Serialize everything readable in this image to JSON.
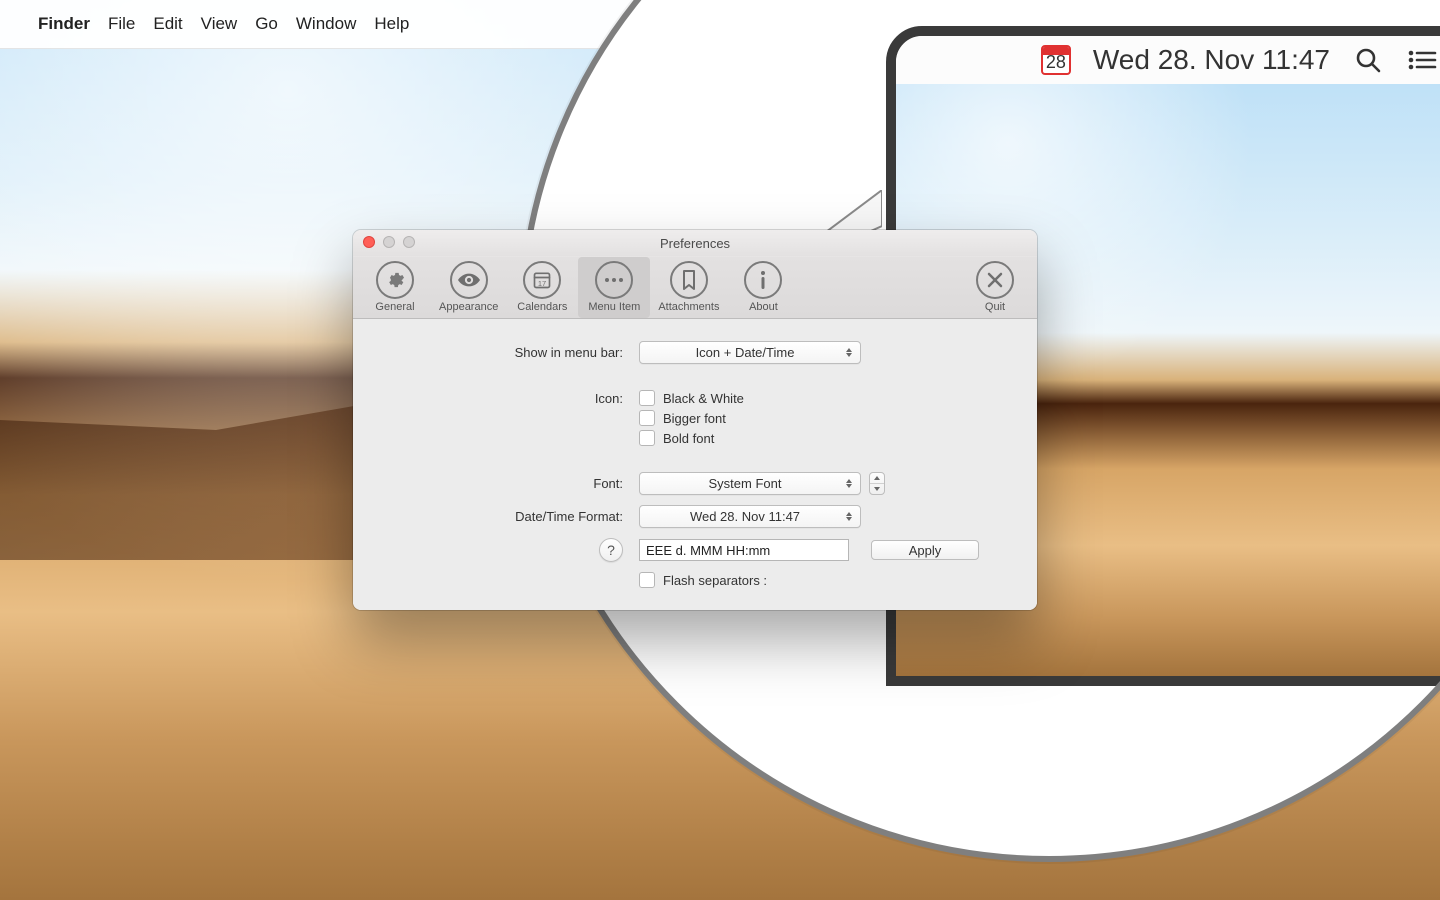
{
  "menubar": {
    "app_name": "Finder",
    "items": [
      "File",
      "Edit",
      "View",
      "Go",
      "Window",
      "Help"
    ]
  },
  "magnifier": {
    "calendar_day": "28",
    "datetime_text": "Wed 28. Nov 11:47"
  },
  "window": {
    "title": "Preferences",
    "toolbar": {
      "general": "General",
      "appearance": "Appearance",
      "calendars": "Calendars",
      "menu_item": "Menu Item",
      "attachments": "Attachments",
      "about": "About",
      "quit": "Quit"
    },
    "form": {
      "show_in_menubar_label": "Show in menu bar:",
      "show_in_menubar_value": "Icon + Date/Time",
      "icon_label": "Icon:",
      "icon_black_white": "Black & White",
      "icon_bigger_font": "Bigger font",
      "icon_bold_font": "Bold font",
      "font_label": "Font:",
      "font_value": "System Font",
      "datetime_format_label": "Date/Time Format:",
      "datetime_format_value": "Wed 28. Nov 11:47",
      "format_input_value": "EEE d. MMM HH:mm",
      "apply_label": "Apply",
      "help_label": "?",
      "flash_separators_label": "Flash separators :"
    }
  }
}
